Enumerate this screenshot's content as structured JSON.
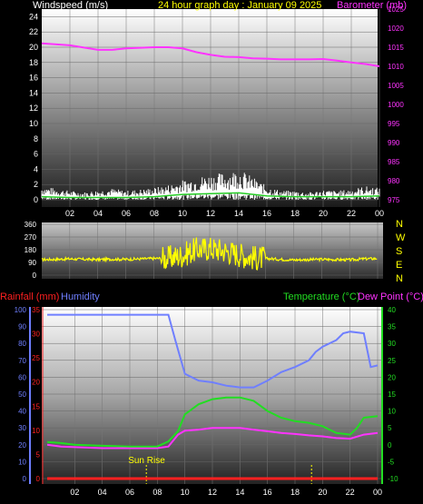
{
  "colors": {
    "windspeed": "#ffffff",
    "gust": "#ffffff",
    "avg_wind": "#22cc22",
    "barometer": "#ff33ff",
    "direction": "#ffff00",
    "humidity": "#6f7fff",
    "temperature": "#22dd22",
    "dewpoint": "#ff33ff",
    "rainfall": "#ff2020",
    "sun": "#ffff00",
    "left_axis_wind": "#ffffff",
    "right_axis_baro": "#ff33ff"
  },
  "chart_data": [
    {
      "type": "line",
      "title": "24 hour graph day : January 09 2025",
      "left_label": "Windspeed (m/s)",
      "right_label": "Barometer (mb)",
      "x_ticks": [
        "02",
        "04",
        "06",
        "08",
        "10",
        "12",
        "14",
        "16",
        "18",
        "20",
        "22",
        "00"
      ],
      "y_left_ticks": [
        "0",
        "2",
        "4",
        "6",
        "8",
        "10",
        "12",
        "14",
        "16",
        "18",
        "20",
        "22",
        "24"
      ],
      "y_right_ticks": [
        "975",
        "980",
        "985",
        "990",
        "995",
        "1000",
        "1005",
        "1010",
        "1015",
        "1020",
        "1025"
      ],
      "ylim_left": [
        0,
        25
      ],
      "ylim_right": [
        975,
        1025
      ],
      "series": [
        {
          "name": "Barometer (mb)",
          "axis": "right",
          "x": [
            0,
            2,
            4,
            5,
            6,
            8,
            9,
            10,
            11,
            12,
            13,
            14,
            15,
            16,
            17,
            18,
            19,
            20,
            21,
            22,
            23,
            24
          ],
          "values": [
            1016,
            1015.5,
            1014.3,
            1014.3,
            1014.7,
            1015,
            1015,
            1014.7,
            1013.7,
            1013,
            1012.5,
            1012.4,
            1012.1,
            1012,
            1011.8,
            1011.8,
            1011.8,
            1011.9,
            1011.5,
            1011,
            1010.6,
            1010
          ]
        },
        {
          "name": "Wind gust",
          "axis": "left",
          "x": [
            0,
            1,
            2,
            3,
            4,
            5,
            6,
            7,
            8,
            9,
            10,
            11,
            12,
            13,
            14,
            15,
            16,
            17,
            18,
            19,
            20,
            21,
            22,
            23,
            24
          ],
          "values": [
            1.8,
            1.5,
            1.2,
            1.0,
            1.3,
            1.5,
            1.2,
            1.4,
            1.6,
            2.0,
            2.6,
            3.0,
            3.4,
            3.6,
            4.1,
            3.0,
            1.8,
            1.2,
            1.2,
            1.0,
            1.3,
            1.2,
            1.4,
            1.8,
            1.6
          ]
        },
        {
          "name": "Average wind",
          "axis": "left",
          "x": [
            0,
            2,
            4,
            6,
            8,
            10,
            12,
            14,
            16,
            18,
            20,
            22,
            24
          ],
          "values": [
            0.4,
            0.3,
            0.3,
            0.3,
            0.4,
            0.7,
            0.8,
            0.9,
            0.5,
            0.4,
            0.4,
            0.4,
            0.5
          ]
        }
      ]
    },
    {
      "type": "scatter",
      "y_ticks": [
        "0",
        "90",
        "180",
        "270",
        "360"
      ],
      "ylim": [
        0,
        360
      ],
      "direction_labels": [
        "N",
        "W",
        "S",
        "E",
        "N"
      ],
      "series": [
        {
          "name": "Wind direction",
          "x": [
            0,
            1,
            2,
            3,
            4,
            5,
            6,
            7,
            8,
            9,
            10,
            11,
            12,
            13,
            14,
            15,
            16,
            17,
            18,
            19,
            20,
            21,
            22,
            23,
            24
          ],
          "values": [
            110,
            112,
            115,
            112,
            110,
            113,
            112,
            115,
            118,
            120,
            140,
            180,
            190,
            175,
            150,
            125,
            118,
            112,
            108,
            110,
            112,
            110,
            108,
            115,
            118
          ]
        }
      ]
    },
    {
      "type": "line",
      "left_label_rain": "Rainfall (mm)",
      "left_label_hum": "Humidity",
      "right_label_temp": "Temperature (°C)",
      "right_label_dew": "Dew Point (°C)",
      "x_ticks": [
        "02",
        "04",
        "06",
        "08",
        "10",
        "12",
        "14",
        "16",
        "18",
        "20",
        "22",
        "00"
      ],
      "humidity_ticks": [
        "0",
        "10",
        "20",
        "30",
        "40",
        "50",
        "60",
        "70",
        "80",
        "90",
        "100"
      ],
      "rain_ticks": [
        "0",
        "5",
        "10",
        "15",
        "20",
        "25",
        "30",
        "35"
      ],
      "temp_ticks": [
        "-10",
        "-5",
        "0",
        "5",
        "10",
        "15",
        "20",
        "25",
        "30",
        "35",
        "40"
      ],
      "ylim_humidity": [
        0,
        100
      ],
      "ylim_rain": [
        0,
        35
      ],
      "ylim_temp": [
        -10,
        40
      ],
      "sun_rise_label": "Sun Rise",
      "sun_rise_hour": 7.2,
      "sun_set_hour": 19.2,
      "series": [
        {
          "name": "Humidity",
          "axis": "humidity",
          "x": [
            0,
            1,
            2,
            4,
            6,
            7,
            8,
            8.8,
            9.3,
            10,
            11,
            12,
            13,
            14,
            15,
            16,
            17,
            18,
            19,
            19.5,
            20,
            21,
            21.5,
            22,
            23,
            23.5,
            24
          ],
          "values": [
            97,
            97,
            97,
            97,
            97,
            97,
            97,
            97,
            82,
            62,
            58,
            57,
            55,
            54,
            54,
            58,
            63,
            66,
            70,
            75,
            78,
            82,
            86,
            87,
            86,
            66,
            67
          ]
        },
        {
          "name": "Temperature (°C)",
          "axis": "temp",
          "x": [
            0,
            1,
            2,
            4,
            6,
            7,
            8,
            8.8,
            9.5,
            10,
            11,
            12,
            13,
            14,
            15,
            16,
            17,
            18,
            19,
            19.5,
            20,
            21,
            22,
            22.5,
            23,
            24
          ],
          "values": [
            0.8,
            0.5,
            0.0,
            -0.3,
            -0.5,
            -0.5,
            -0.5,
            1.0,
            4.0,
            9.0,
            12.0,
            13.5,
            14.0,
            14.0,
            13.0,
            10.0,
            8.0,
            7.0,
            6.5,
            6.0,
            5.5,
            3.5,
            3.0,
            5.0,
            8.0,
            8.5
          ]
        },
        {
          "name": "Dew Point (°C)",
          "axis": "temp",
          "x": [
            0,
            1,
            2,
            4,
            6,
            7,
            8,
            8.8,
            9.5,
            10,
            11,
            12,
            13,
            14,
            15,
            16,
            17,
            18,
            19,
            20,
            21,
            22,
            23,
            24
          ],
          "values": [
            0.0,
            -0.5,
            -0.7,
            -1.0,
            -1.0,
            -1.0,
            -1.0,
            -0.5,
            3.0,
            4.2,
            4.5,
            5.0,
            5.0,
            5.0,
            4.5,
            4.0,
            3.5,
            3.2,
            2.8,
            2.5,
            2.0,
            1.8,
            3.0,
            3.5
          ]
        },
        {
          "name": "Rainfall (mm)",
          "axis": "rain",
          "x": [
            0,
            24
          ],
          "values": [
            0,
            0
          ]
        }
      ]
    }
  ]
}
